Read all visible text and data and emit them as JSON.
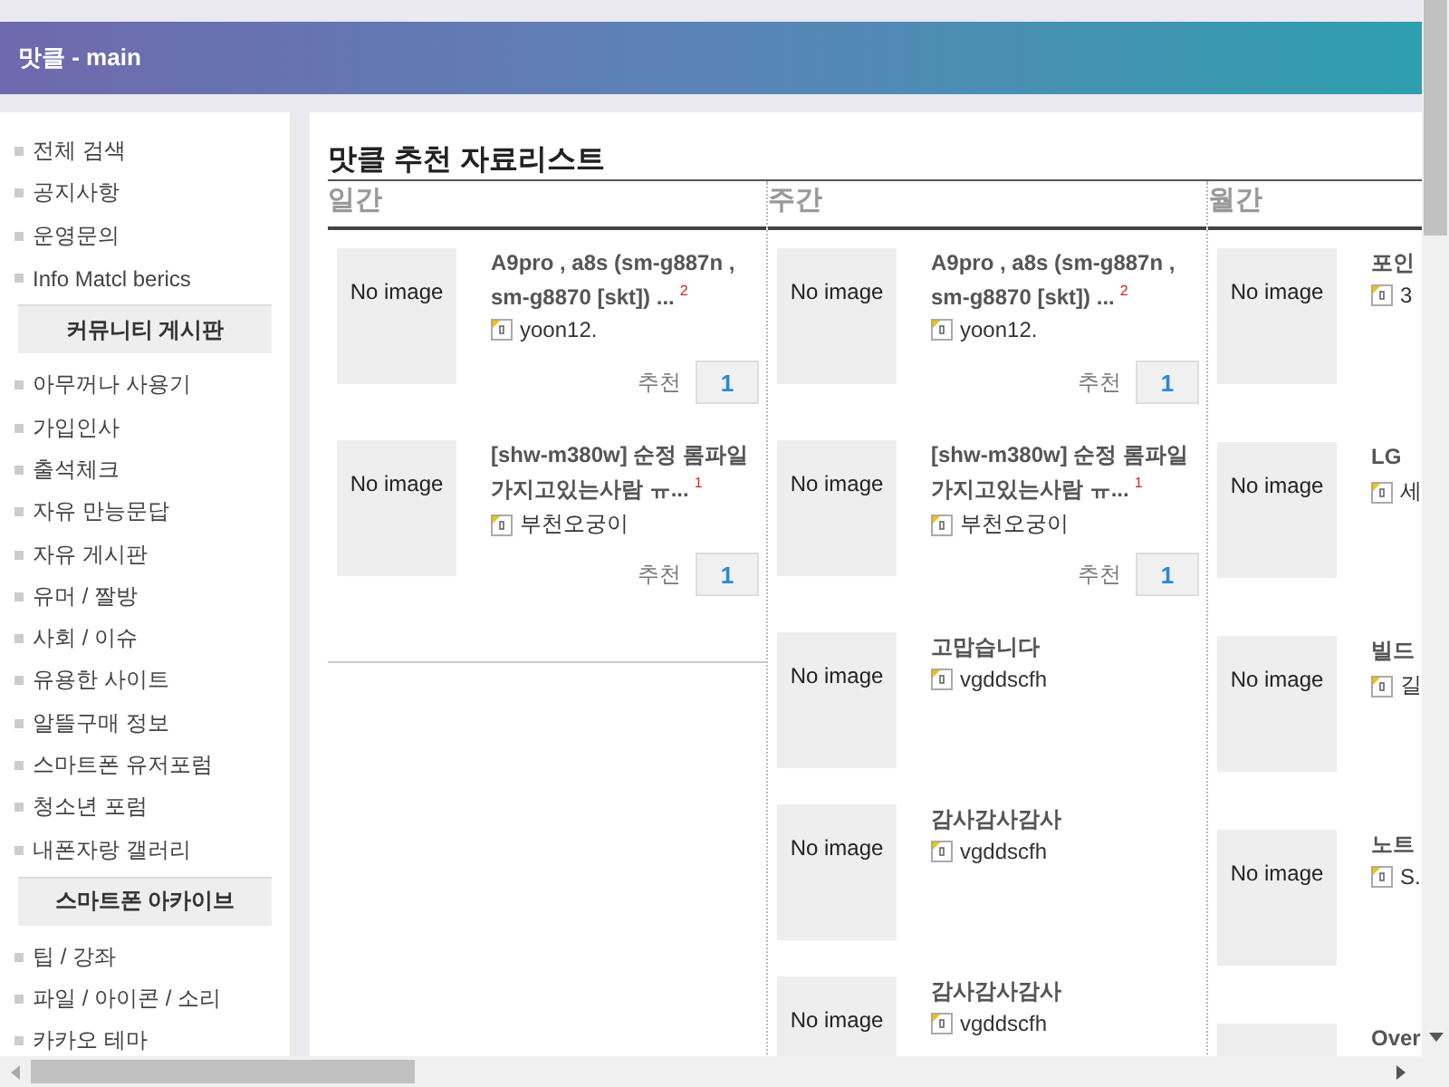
{
  "header": {
    "title": "맛클 - main"
  },
  "sidebar": {
    "groups": [
      {
        "items": [
          "전체 검색",
          "공지사항",
          "운영문의",
          "Info Matcl berics"
        ]
      },
      {
        "title": "커뮤니티 게시판",
        "items": [
          "아무꺼나 사용기",
          "가입인사",
          "출석체크",
          "자유 만능문답",
          "자유 게시판",
          "유머 / 짤방",
          "사회 / 이슈",
          "유용한 사이트",
          "알뜰구매 정보",
          "스마트폰 유저포럼",
          "청소년 포럼",
          "내폰자랑 갤러리"
        ]
      },
      {
        "title": "스마트폰 아카이브",
        "items": [
          "팁 / 강좌",
          "파일 / 아이콘 / 소리",
          "카카오 테마"
        ]
      }
    ]
  },
  "main": {
    "title": "맛클 추천 자료리스트",
    "columns": [
      {
        "heading": "일간",
        "items": [
          {
            "thumb": "No image",
            "title": "A9pro , a8s (sm-g887n , sm-g8870 [skt]) ...",
            "comments": "2",
            "author": "yoon12.",
            "vote_label": "추천",
            "votes": "1"
          },
          {
            "thumb": "No image",
            "title": "[shw-m380w] 순정 롬파일 가지고있는사람 ㅠ...",
            "comments": "1",
            "author": "부천오궁이",
            "vote_label": "추천",
            "votes": "1"
          }
        ]
      },
      {
        "heading": "주간",
        "items": [
          {
            "thumb": "No image",
            "title": "A9pro , a8s (sm-g887n , sm-g8870 [skt]) ...",
            "comments": "2",
            "author": "yoon12.",
            "vote_label": "추천",
            "votes": "1"
          },
          {
            "thumb": "No image",
            "title": "[shw-m380w] 순정 롬파일 가지고있는사람 ㅠ...",
            "comments": "1",
            "author": "부천오궁이",
            "vote_label": "추천",
            "votes": "1"
          },
          {
            "thumb": "No image",
            "title": "고맙습니다",
            "author": "vgddscfh"
          },
          {
            "thumb": "No image",
            "title": "감사감사감사",
            "author": "vgddscfh"
          },
          {
            "thumb": "No image",
            "title": "감사감사감사",
            "author": "vgddscfh"
          }
        ]
      },
      {
        "heading": "월간",
        "items": [
          {
            "thumb": "No image",
            "title": "포인",
            "author": "3"
          },
          {
            "thumb": "No image",
            "title": "LG",
            "author": "세"
          },
          {
            "thumb": "No image",
            "title": "빌드",
            "author": "길"
          },
          {
            "thumb": "No image",
            "title": "노트",
            "author": "S."
          },
          {
            "title": "Over"
          }
        ]
      }
    ]
  }
}
